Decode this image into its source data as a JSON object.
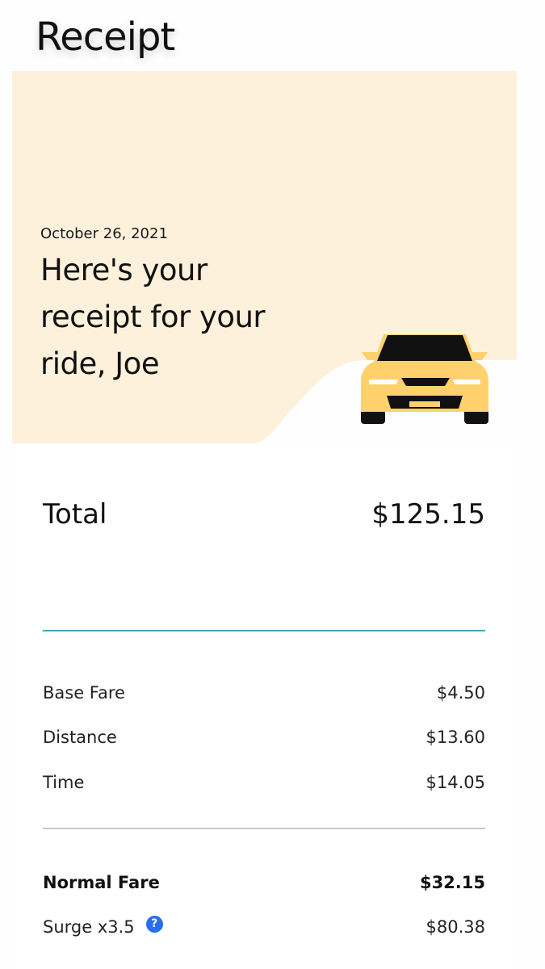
{
  "header": {
    "title": "Receipt"
  },
  "hero": {
    "date": "October 26, 2021",
    "heading": "Here's your receipt for your ride, Joe",
    "background_color": "#fdf1db",
    "car_icon": "car-icon",
    "car_color": "#ffd16c"
  },
  "summary": {
    "total_label": "Total",
    "total_amount": "$125.15",
    "accent_color": "#3fa7b8"
  },
  "line_items": [
    {
      "label": "Base Fare",
      "amount": "$4.50"
    },
    {
      "label": "Distance",
      "amount": "$13.60"
    },
    {
      "label": "Time",
      "amount": "$14.05"
    }
  ],
  "fare": {
    "normal_label": "Normal Fare",
    "normal_amount": "$32.15",
    "surge_label": "Surge x3.5",
    "surge_amount": "$80.38",
    "help_icon": "question-mark-icon",
    "help_symbol": "?",
    "help_color": "#276ef1"
  }
}
